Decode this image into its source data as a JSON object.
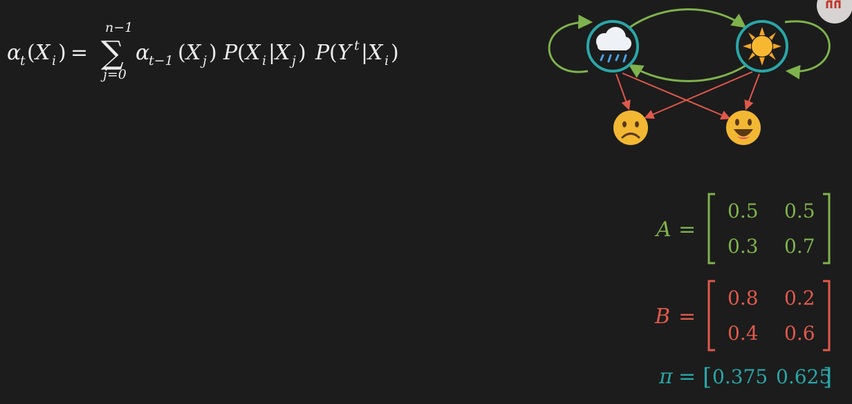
{
  "formula": {
    "alpha": "α",
    "sub_t": "t",
    "X": "X",
    "sub_i": "i",
    "equals": "=",
    "sum_symbol": "∑",
    "sum_upper": "n−1",
    "sum_lower": "j=0",
    "sub_t_minus_1": "t−1",
    "sub_j": "j",
    "P": "P",
    "Y": "Y",
    "sup_t": "t",
    "paren_open": "(",
    "paren_close": ")",
    "bar": "|"
  },
  "diagram": {
    "states": [
      {
        "name": "rainy",
        "icon": "rain-cloud-icon"
      },
      {
        "name": "sunny",
        "icon": "sun-icon"
      }
    ],
    "observations": [
      {
        "name": "sad",
        "icon": "sad-face-icon"
      },
      {
        "name": "happy",
        "icon": "happy-face-icon"
      }
    ],
    "colors": {
      "state_ring": "#2aa6a8",
      "transition_arrow": "#7fb24d",
      "emission_arrow": "#e0594b",
      "face": "#f2b733"
    }
  },
  "matrices": {
    "A": {
      "label": "A",
      "equals": "=",
      "rows": [
        [
          "0.5",
          "0.5"
        ],
        [
          "0.3",
          "0.7"
        ]
      ],
      "color": "#7fb24d"
    },
    "B": {
      "label": "B",
      "equals": "=",
      "rows": [
        [
          "0.8",
          "0.2"
        ],
        [
          "0.4",
          "0.6"
        ]
      ],
      "color": "#e0594b"
    },
    "pi": {
      "label": "π",
      "equals": "=",
      "values": [
        "0.375",
        "0.625"
      ],
      "open": "[",
      "close": "]",
      "color": "#2aa6a8"
    }
  },
  "corner_badge": {
    "icon": "channel-logo-icon"
  }
}
